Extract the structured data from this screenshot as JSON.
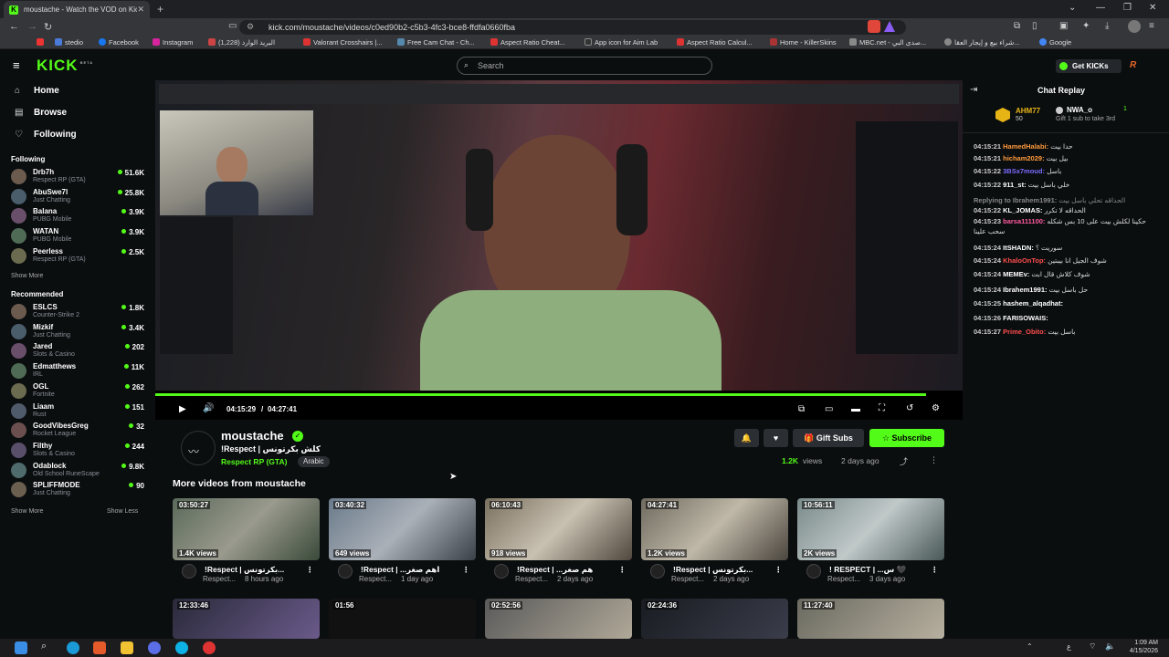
{
  "browser": {
    "tab_title": "moustache - Watch the VOD on Kick",
    "url": "kick.com/moustache/videos/c0ed90b2-c5b3-4fc3-bce8-ffdfa0660fba",
    "bookmarks": [
      "stedio",
      "Facebook",
      "Instagram",
      "(1,228) البريد الوارد",
      "Valorant Crosshairs |...",
      "Free Cam Chat - Ch...",
      "Aspect Ratio Cheat...",
      "App icon for Aim Lab",
      "Aspect Ratio Calcul...",
      "Home - KillerSkins",
      "MBC.net - صدى البي...",
      "شراء بيع و إيجار العقا...",
      "Google"
    ]
  },
  "header": {
    "logo": "KICK",
    "logo_sup": "BETA",
    "search_placeholder": "Search",
    "get_kicks": "Get KICKs"
  },
  "sidebar": {
    "nav": [
      {
        "label": "Home",
        "icon": "home-icon"
      },
      {
        "label": "Browse",
        "icon": "browse-icon"
      },
      {
        "label": "Following",
        "icon": "heart-icon"
      }
    ],
    "following_title": "Following",
    "following": [
      {
        "name": "Drb7h",
        "game": "Respect RP (GTA)",
        "viewers": "51.6K"
      },
      {
        "name": "AbuSwe7l",
        "game": "Just Chatting",
        "viewers": "25.8K"
      },
      {
        "name": "Balana",
        "game": "PUBG Mobile",
        "viewers": "3.9K"
      },
      {
        "name": "WATAN",
        "game": "PUBG Mobile",
        "viewers": "3.9K"
      },
      {
        "name": "Peerless",
        "game": "Respect RP (GTA)",
        "viewers": "2.5K"
      }
    ],
    "show_more": "Show More",
    "recommended_title": "Recommended",
    "recommended": [
      {
        "name": "ESLCS",
        "game": "Counter-Strike 2",
        "viewers": "1.8K"
      },
      {
        "name": "Mizkif",
        "game": "Just Chatting",
        "viewers": "3.4K"
      },
      {
        "name": "Jared",
        "game": "Slots & Casino",
        "viewers": "202"
      },
      {
        "name": "Edmatthews",
        "game": "IRL",
        "viewers": "11K"
      },
      {
        "name": "OGL",
        "game": "Fortnite",
        "viewers": "262"
      },
      {
        "name": "Liaam",
        "game": "Rust",
        "viewers": "151"
      },
      {
        "name": "GoodVibesGreg",
        "game": "Rocket League",
        "viewers": "32"
      },
      {
        "name": "Filthy",
        "game": "Slots & Casino",
        "viewers": "244"
      },
      {
        "name": "Odablock",
        "game": "Old School RuneScape",
        "viewers": "9.8K"
      },
      {
        "name": "SPLIFFMODE",
        "game": "Just Chatting",
        "viewers": "90"
      }
    ],
    "show_more2": "Show More",
    "show_less": "Show Less"
  },
  "player": {
    "time_current": "04:15:29",
    "time_sep": "/",
    "time_total": "04:27:41",
    "progress": 0.955
  },
  "stream": {
    "channel": "moustache",
    "title": "!Respect | كلش بكرتونس",
    "category": "Respect RP (GTA)",
    "tag": "Arabic",
    "views": "1.2K",
    "views_label": "views",
    "ago": "2 days ago",
    "gift_subs": "Gift Subs",
    "subscribe": "Subscribe"
  },
  "more_videos_title": "More videos from moustache",
  "videos": [
    {
      "duration": "03:50:27",
      "views": "1.4K views",
      "title": "!Respect | بكرتونس...",
      "channel": "Respect...",
      "ago": "8 hours ago"
    },
    {
      "duration": "03:40:32",
      "views": "649 views",
      "title": "!Respect | ...اهم صغر",
      "channel": "Respect...",
      "ago": "1 day ago"
    },
    {
      "duration": "06:10:43",
      "views": "918 views",
      "title": "!Respect | ...هم صغر",
      "channel": "Respect...",
      "ago": "2 days ago"
    },
    {
      "duration": "04:27:41",
      "views": "1.2K views",
      "title": "!Respect | بكرتونس...",
      "channel": "Respect...",
      "ago": "2 days ago"
    },
    {
      "duration": "10:56:11",
      "views": "2K views",
      "title": "! RESPECT | ...س 🖤",
      "channel": "Respect...",
      "ago": "3 days ago"
    }
  ],
  "videos_row2": [
    "12:33:46",
    "01:56",
    "02:52:56",
    "02:24:36",
    "11:27:40"
  ],
  "chat": {
    "title": "Chat Replay",
    "top_gifter": "AHM77",
    "top_gifter_count": "50",
    "second_gifter": "NWA_o",
    "second_gifter_count": "1",
    "gift_hint": "Gift 1 sub to take 3rd",
    "messages": [
      {
        "time": "04:15:21",
        "user": "HamedHalabi:",
        "text": "حدا بيت",
        "color": "#ff9a3c"
      },
      {
        "time": "04:15:21",
        "user": "hicham2029:",
        "text": "بيل بيت",
        "color": "#ff9a3c"
      },
      {
        "time": "04:15:22",
        "user": "3BSx7moud:",
        "text": "باسل",
        "color": "#7a6cff"
      },
      {
        "time": "04:15:22",
        "user": "911_st:",
        "text": "خلي باسل بيت",
        "color": "#ffffff"
      },
      {
        "time": "",
        "user": "Replying to Ibrahem1991:",
        "text": "الحداقه تحلي باسل بيت",
        "color": "#888888"
      },
      {
        "time": "04:15:22",
        "user": "KL_JOMAS:",
        "text": "الحداقه لا تكرر",
        "color": "#ffffff"
      },
      {
        "time": "04:15:23",
        "user": "barsa111100:",
        "text": "حكينا لكلش بيت على 10 بس شكله",
        "color": "#ff5aa0"
      },
      {
        "time": "",
        "user": "",
        "text": "سحب علينا",
        "color": "#ffffff"
      },
      {
        "time": "04:15:24",
        "user": "ItSHADN:",
        "text": "سوريت ؟",
        "color": "#ffffff"
      },
      {
        "time": "04:15:24",
        "user": "KhaloOnTop:",
        "text": "شوف الجيل انا بيبتين",
        "color": "#ff4d4d"
      },
      {
        "time": "04:15:24",
        "user": "MEMEv:",
        "text": "شوف كلاش قال ابت",
        "color": "#ffffff"
      },
      {
        "time": "04:15:24",
        "user": "Ibrahem1991:",
        "text": "حل باسل بيت",
        "color": "#ffffff"
      },
      {
        "time": "04:15:25",
        "user": "hashem_alqadhat:",
        "text": "",
        "color": "#ffffff"
      },
      {
        "time": "04:15:26",
        "user": "FARISOWAIS:",
        "text": "",
        "color": "#ffffff"
      },
      {
        "time": "04:15:27",
        "user": "Prime_Obito:",
        "text": "باسل بيت",
        "color": "#ff4d4d"
      }
    ]
  },
  "taskbar": {
    "time": "1:09 AM",
    "date": "4/15/2026"
  },
  "colors": {
    "accent": "#53fc18",
    "bg": "#0b0e0f"
  }
}
